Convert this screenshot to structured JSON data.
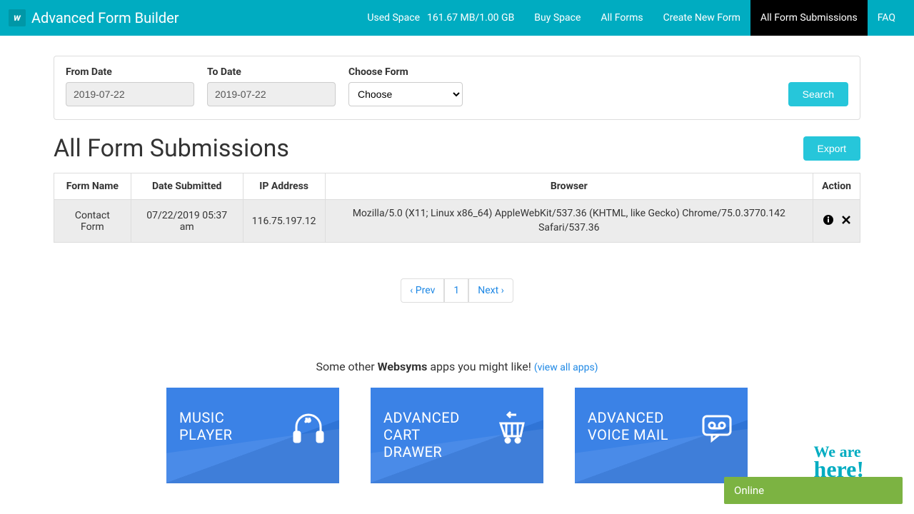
{
  "nav": {
    "brand": "Advanced Form Builder",
    "used_space_label": "Used Space",
    "used_space_value": "161.67 MB/1.00 GB",
    "buy_space": "Buy Space",
    "all_forms": "All Forms",
    "create_new": "Create New Form",
    "all_submissions": "All Form Submissions",
    "faq": "FAQ"
  },
  "filters": {
    "from_label": "From Date",
    "from_value": "2019-07-22",
    "to_label": "To Date",
    "to_value": "2019-07-22",
    "choose_label": "Choose Form",
    "choose_option": "Choose",
    "search_btn": "Search"
  },
  "page": {
    "title": "All Form Submissions",
    "export_btn": "Export"
  },
  "table": {
    "headers": {
      "form_name": "Form Name",
      "date_submitted": "Date Submitted",
      "ip": "IP Address",
      "browser": "Browser",
      "action": "Action"
    },
    "row": {
      "form_name": "Contact Form",
      "date_submitted": "07/22/2019 05:37 am",
      "ip": "116.75.197.12",
      "browser": "Mozilla/5.0 (X11; Linux x86_64) AppleWebKit/537.36 (KHTML, like Gecko) Chrome/75.0.3770.142 Safari/537.36"
    }
  },
  "pagination": {
    "prev": "‹ Prev",
    "page": "1",
    "next": "Next ›"
  },
  "promo": {
    "text_a": "Some other ",
    "text_bold": "Websyms",
    "text_b": " apps you might like! ",
    "link": "(view all apps)",
    "card1": "MUSIC PLAYER",
    "card2": "ADVANCED CART DRAWER",
    "card3": "ADVANCED VOICE MAIL"
  },
  "chat": {
    "we": "We are",
    "here": "here!",
    "online": "Online"
  }
}
